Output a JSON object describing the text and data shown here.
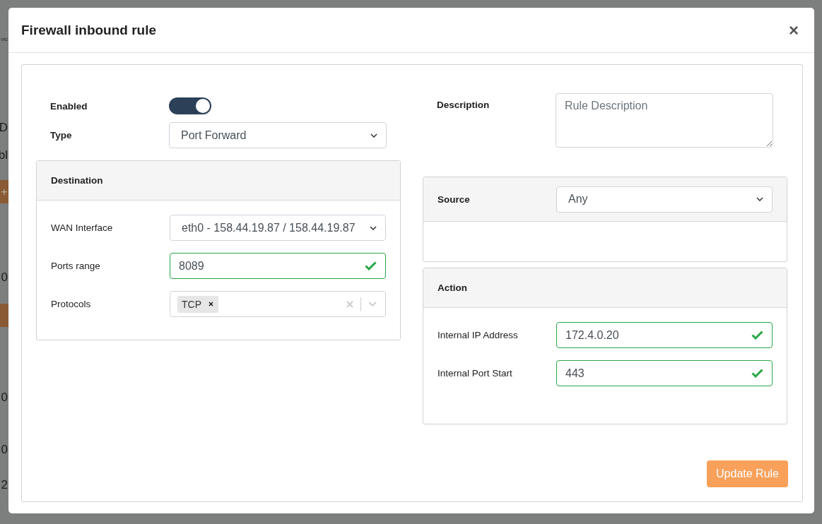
{
  "background": {
    "fragments": [
      {
        "kind": "small",
        "text": "vic"
      },
      {
        "kind": "text",
        "text": "D"
      },
      {
        "kind": "text",
        "text": "bl"
      },
      {
        "kind": "button",
        "text": "+"
      },
      {
        "kind": "text",
        "text": "0"
      },
      {
        "kind": "button"
      },
      {
        "kind": "text",
        "text": "0"
      },
      {
        "kind": "text",
        "text": "0"
      },
      {
        "kind": "text",
        "text": "2"
      }
    ]
  },
  "modal": {
    "title": "Firewall inbound rule",
    "close": "×"
  },
  "enabled": {
    "label": "Enabled",
    "on": true
  },
  "type": {
    "label": "Type",
    "value": "Port Forward"
  },
  "description": {
    "label": "Description",
    "placeholder": "Rule Description"
  },
  "destination": {
    "title": "Destination",
    "fields": [
      {
        "kind": "select",
        "label": "WAN Interface",
        "value": "eth0 - 158.44.19.87 / 158.44.19.87"
      },
      {
        "kind": "input",
        "label": "Ports range",
        "value": "8089",
        "valid": true
      },
      {
        "kind": "multiselect",
        "label": "Protocols",
        "tags": [
          "TCP"
        ]
      }
    ]
  },
  "source": {
    "title": "Source",
    "value": "Any"
  },
  "action": {
    "title": "Action",
    "fields": [
      {
        "kind": "input",
        "label": "Internal IP Address",
        "value": "172.4.0.20",
        "valid": true
      },
      {
        "kind": "input",
        "label": "Internal Port Start",
        "value": "443",
        "valid": true
      }
    ]
  },
  "submit": "Update Rule"
}
